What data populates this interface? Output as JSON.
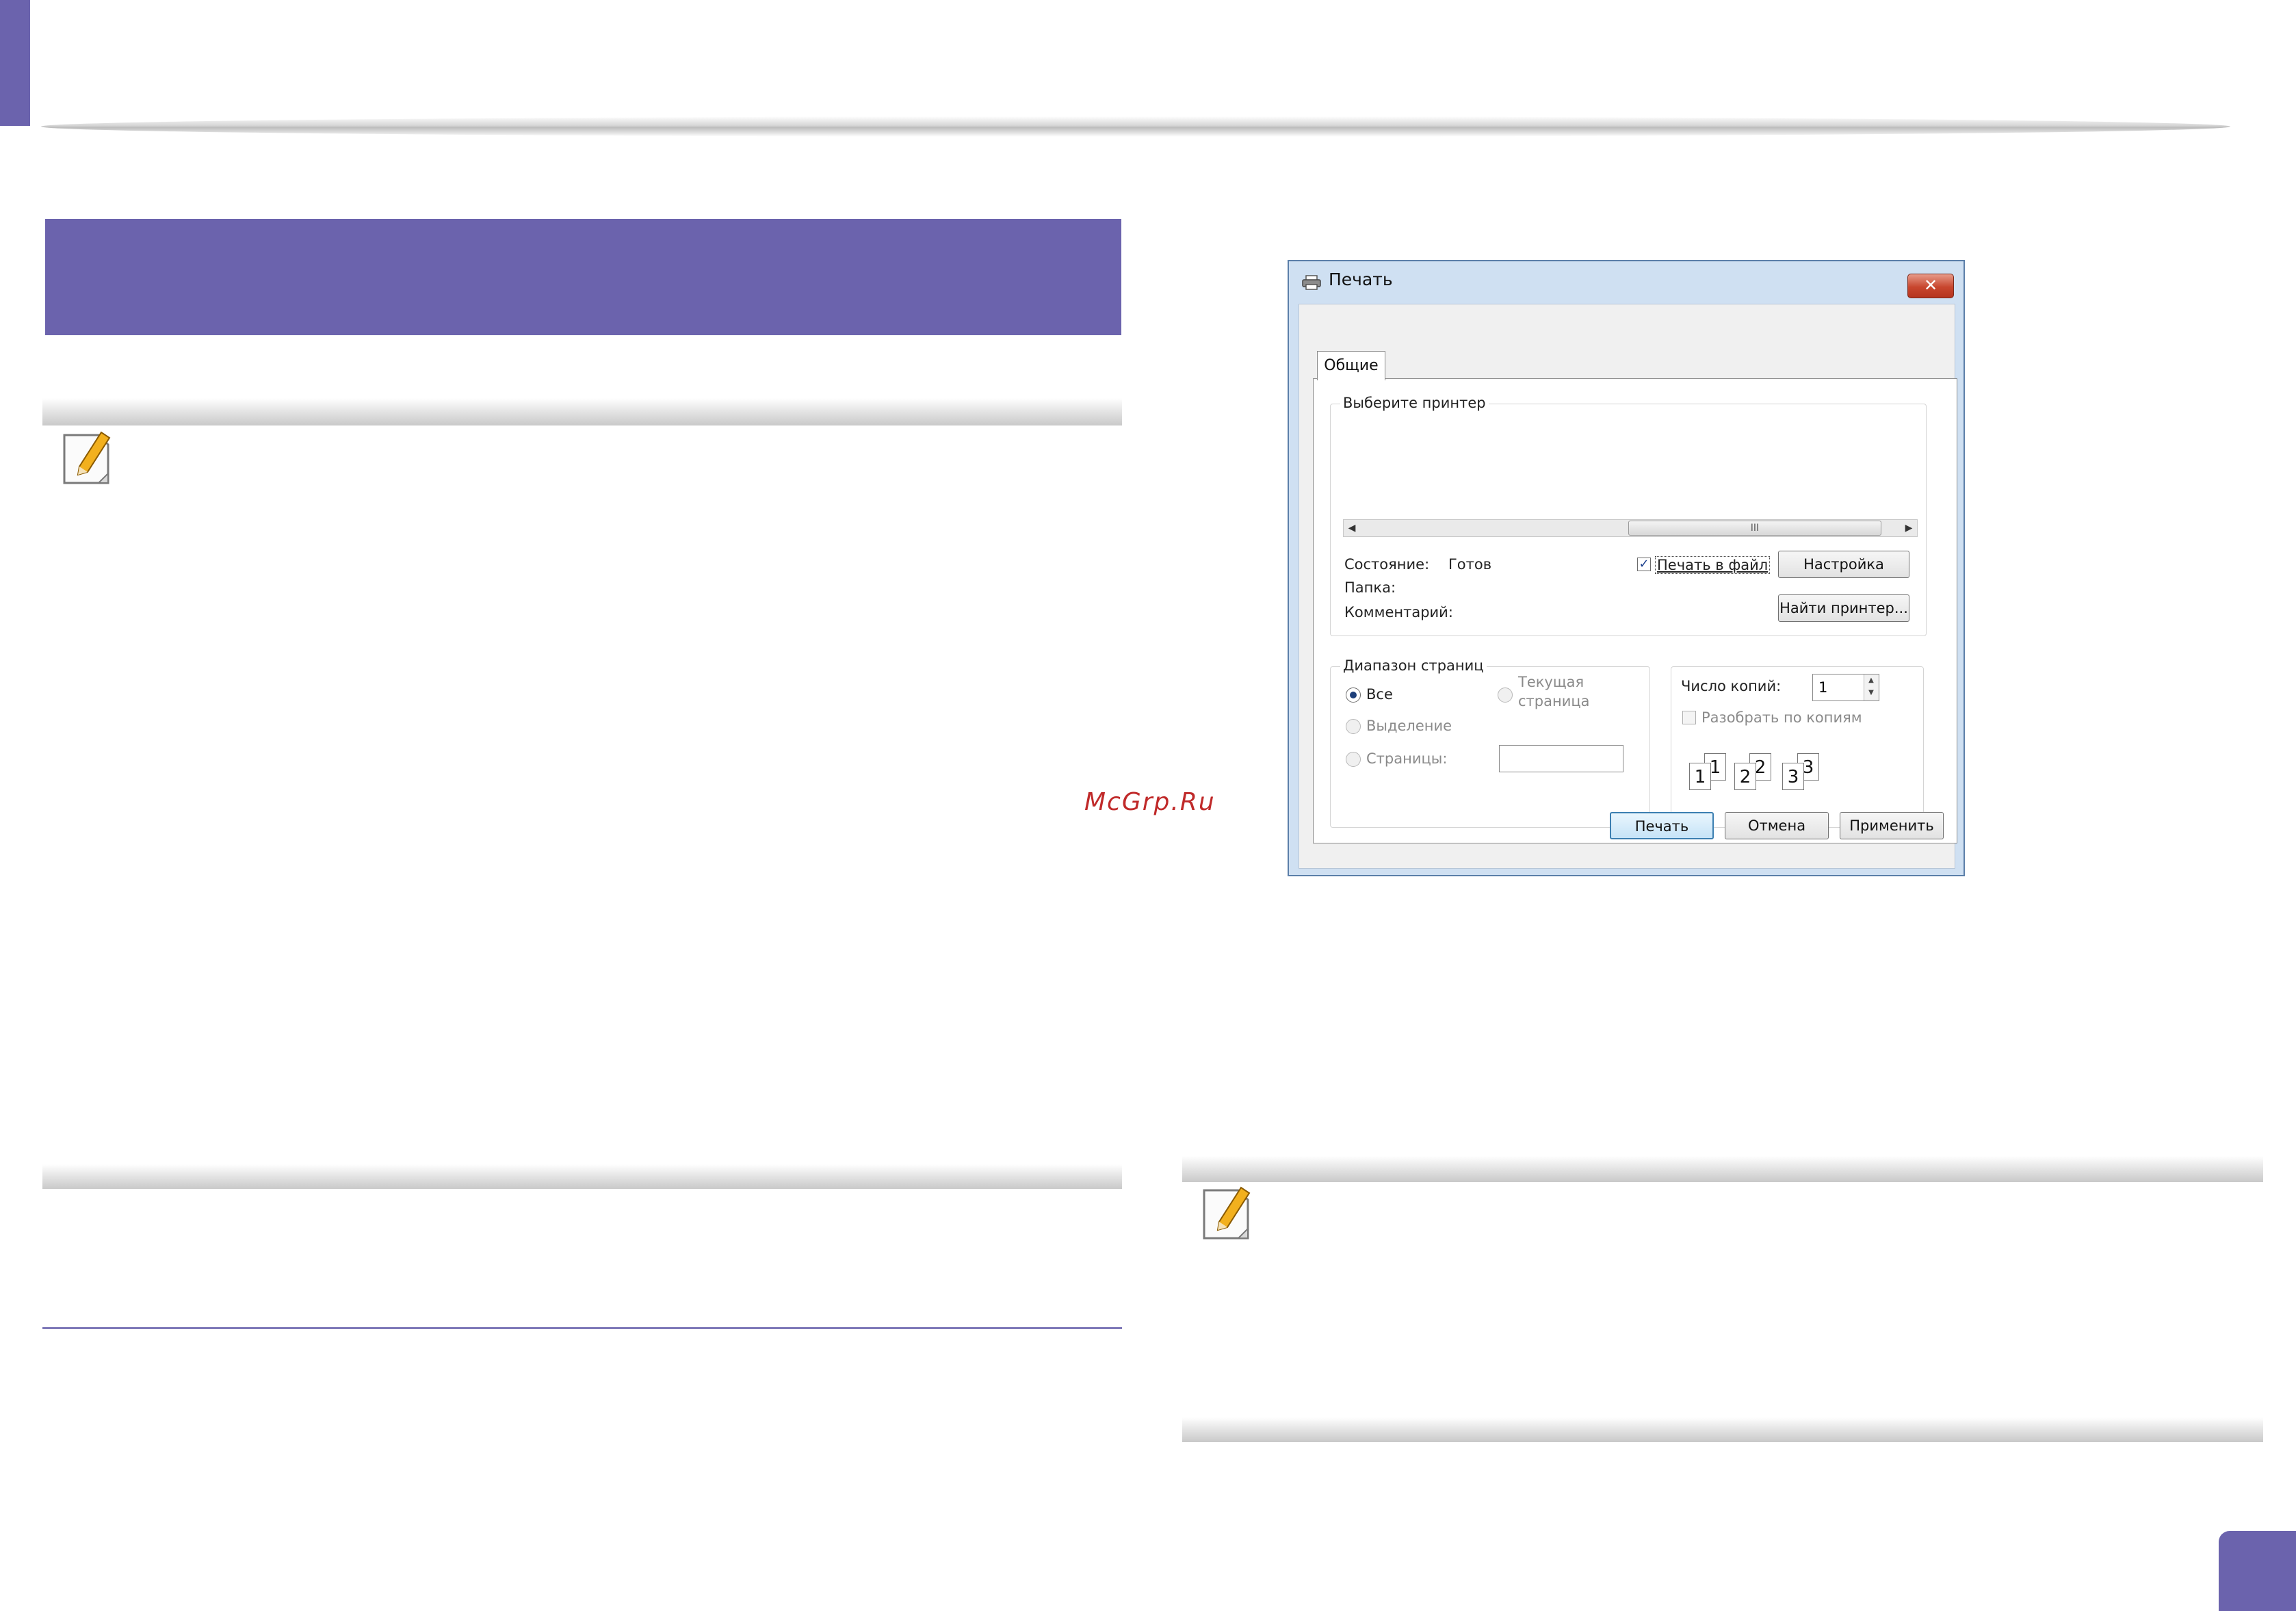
{
  "dialog": {
    "title": "Печать",
    "close_label": "✕",
    "tab_general": "Общие",
    "printer_group": {
      "legend": "Выберите принтер",
      "scroll_thumb_grip": "III",
      "status_label": "Состояние:",
      "status_value": "Готов",
      "folder_label": "Папка:",
      "comment_label": "Комментарий:",
      "print_to_file_label": "Печать в файл",
      "print_to_file_checked": true,
      "settings_button": "Настройка",
      "find_printer_button": "Найти принтер..."
    },
    "page_range_group": {
      "legend": "Диапазон страниц",
      "all_label": "Все",
      "selection_label": "Выделение",
      "current_page_label_line1": "Текущая",
      "current_page_label_line2": "страница",
      "pages_label": "Страницы:",
      "pages_value": ""
    },
    "copies_group": {
      "copies_label": "Число копий:",
      "copies_value": "1",
      "collate_label": "Разобрать по копиям",
      "collate_checked": false,
      "collate_pages": [
        "1",
        "1",
        "2",
        "2",
        "3",
        "3"
      ]
    },
    "buttons": {
      "print": "Печать",
      "cancel": "Отмена",
      "apply": "Применить"
    }
  },
  "watermark": "McGrp.Ru",
  "colors": {
    "accent": "#6b63ad",
    "dialog_frame": "#cfe0f2",
    "close_button": "#c8462e"
  },
  "icons": [
    "note-pencil-icon",
    "printer-icon",
    "close-icon"
  ]
}
